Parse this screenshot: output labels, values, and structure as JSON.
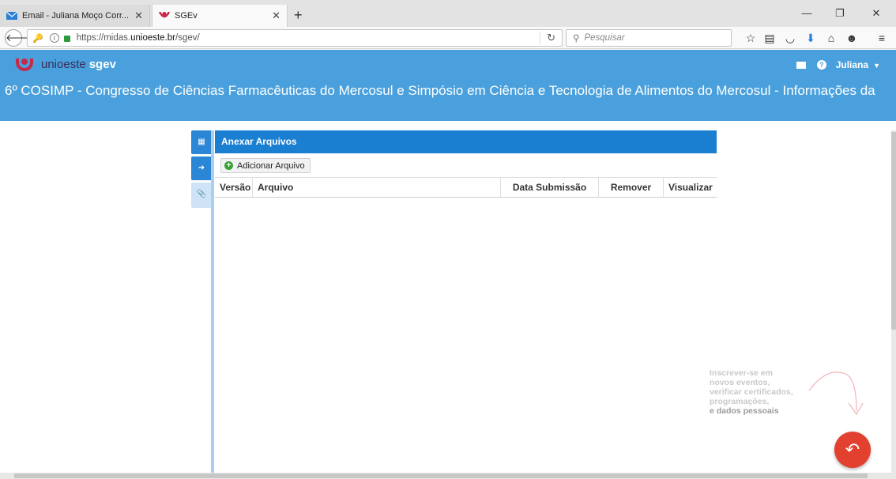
{
  "browser": {
    "tabs": [
      {
        "title": "Email - Juliana Moço Corr...",
        "icon": "outlook-mail-icon"
      },
      {
        "title": "SGEv",
        "icon": "unioeste-logo-icon"
      }
    ],
    "url_prefix": "https://midas.",
    "url_domain": "unioeste.br",
    "url_suffix": "/sgev/",
    "search_placeholder": "Pesquisar"
  },
  "app": {
    "brand_prefix": "unioeste",
    "brand_name": "sgev",
    "user_name": "Juliana",
    "event_title": "6º COSIMP - Congresso de Ciências Farmacêuticas do Mercosul e Simpósio em Ciência e Tecnologia de Alimentos do Mercosul - Informações da",
    "colors": {
      "header": "#4aa0dc",
      "panel_header": "#1a7ed1",
      "fab": "#e24130"
    }
  },
  "panel": {
    "title": "Anexar Arquivos",
    "add_button": "Adicionar Arquivo",
    "columns": [
      "Versão",
      "Arquivo",
      "Data Submissão",
      "Remover",
      "Visualizar"
    ]
  },
  "hint": {
    "lines": [
      "Inscrever-se em",
      "novos eventos,",
      "verificar certificados,",
      "programações,",
      "e dados pessoais"
    ]
  }
}
